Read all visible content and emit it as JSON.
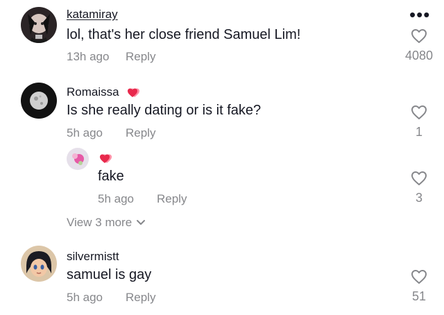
{
  "comments": [
    {
      "username": "katamiray",
      "text": "lol, that's her close friend Samuel Lim!",
      "time": "13h ago",
      "reply_label": "Reply",
      "likes": "4080"
    },
    {
      "username": "Romaissa",
      "text": "Is she really dating or is it fake?",
      "time": "5h ago",
      "reply_label": "Reply",
      "likes": "1",
      "reply": {
        "username": "",
        "text": "fake",
        "time": "5h ago",
        "reply_label": "Reply",
        "likes": "3"
      },
      "view_more": "View 3 more"
    },
    {
      "username": "silvermistt",
      "text": "samuel is gay",
      "time": "5h ago",
      "reply_label": "Reply",
      "likes": "51"
    }
  ],
  "icons": {
    "more": "more-dots-icon",
    "like": "heart-outline-icon",
    "badge": "double-heart-icon",
    "expand": "chevron-down-icon"
  },
  "colors": {
    "text": "#161823",
    "secondary": "#86878b",
    "badge_red": "#e8294c"
  }
}
